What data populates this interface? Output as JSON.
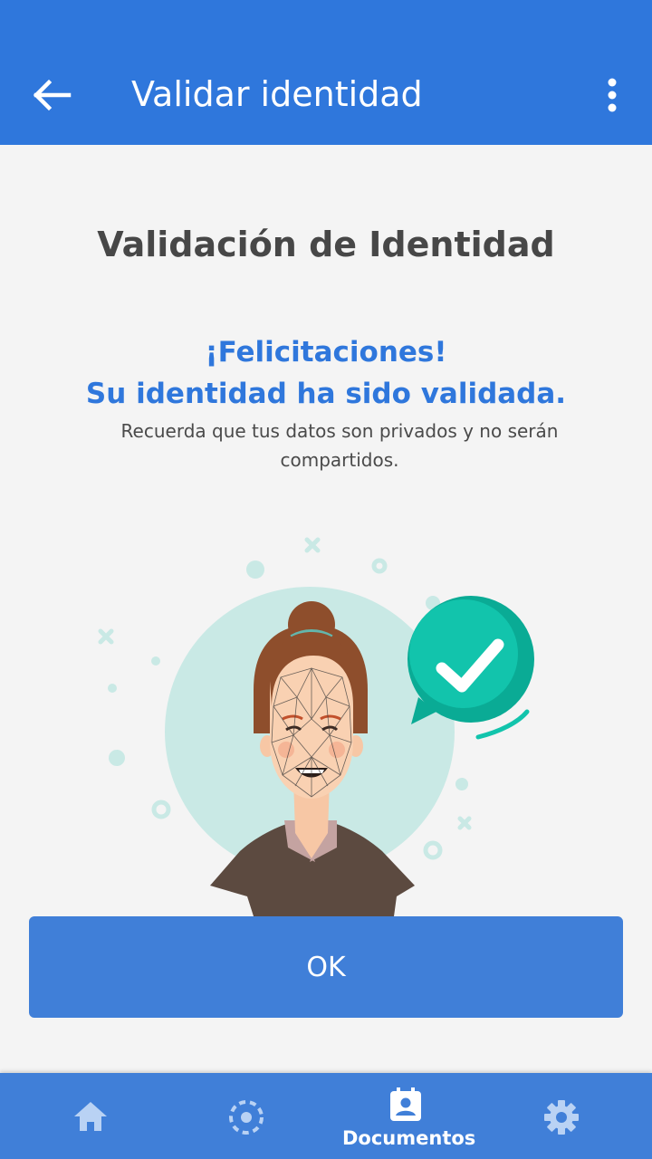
{
  "appbar": {
    "title": "Validar identidad",
    "back_icon": "arrow-back-icon",
    "menu_icon": "more-vert-icon"
  },
  "main": {
    "heading": "Validación de Identidad",
    "congrats_line1": "¡Felicitaciones!",
    "congrats_line2": "Su identidad ha sido validada.",
    "privacy_note": "Recuerda que tus datos son privados y no serán compartidos.",
    "ok_label": "OK"
  },
  "bottom_nav": {
    "items": [
      {
        "icon": "home-icon",
        "label": ""
      },
      {
        "icon": "scan-icon",
        "label": ""
      },
      {
        "icon": "document-icon",
        "label": "Documentos",
        "active": true
      },
      {
        "icon": "settings-icon",
        "label": ""
      }
    ]
  },
  "colors": {
    "primary": "#2f77dc",
    "button": "#407fd8",
    "text_dark": "#474747",
    "accent_teal": "#12c4ac",
    "circle_bg": "#c9e9e5"
  }
}
